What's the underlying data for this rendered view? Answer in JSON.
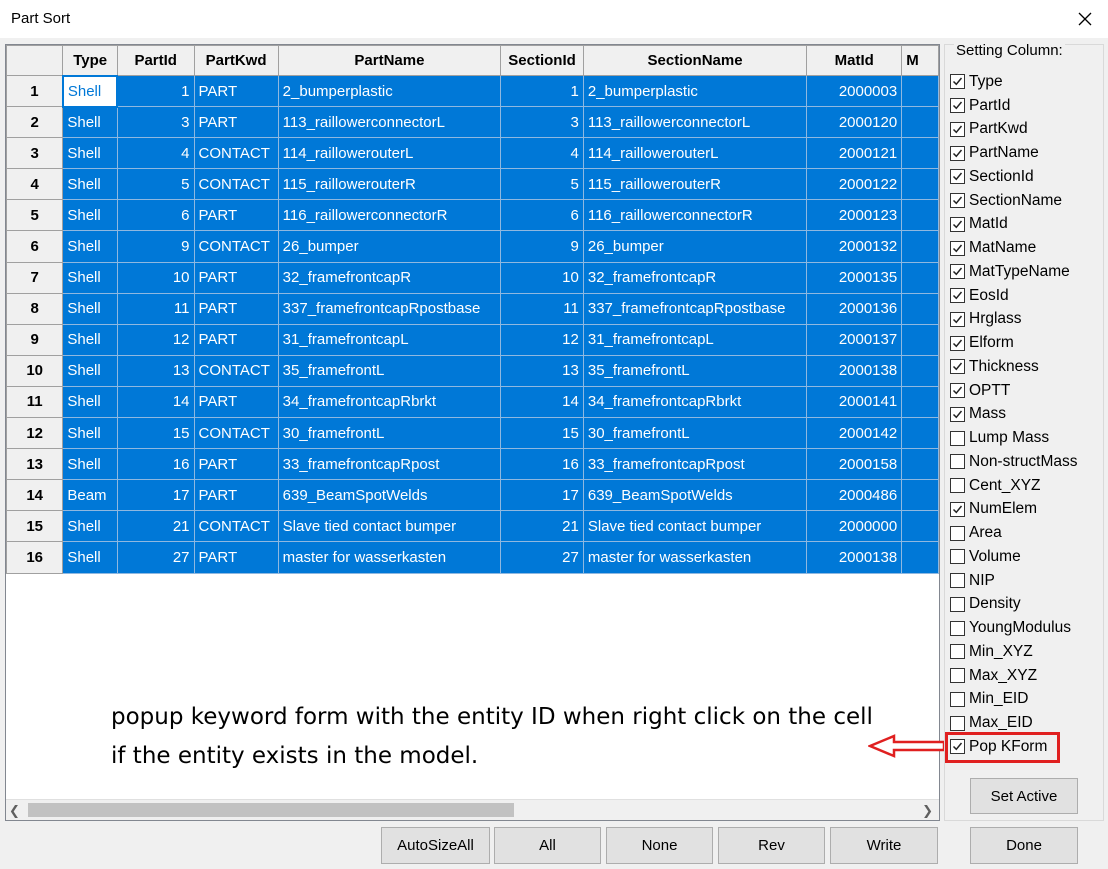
{
  "window": {
    "title": "Part Sort"
  },
  "grid": {
    "columns": [
      "Type",
      "PartId",
      "PartKwd",
      "PartName",
      "SectionId",
      "SectionName",
      "MatId",
      "M"
    ],
    "rows": [
      {
        "no": "1",
        "type": "Shell",
        "partid": "1",
        "partkwd": "PART",
        "partname": "2_bumperplastic",
        "sectionid": "1",
        "sectionname": "2_bumperplastic",
        "matid": "2000003"
      },
      {
        "no": "2",
        "type": "Shell",
        "partid": "3",
        "partkwd": "PART",
        "partname": "113_raillowerconnectorL",
        "sectionid": "3",
        "sectionname": "113_raillowerconnectorL",
        "matid": "2000120"
      },
      {
        "no": "3",
        "type": "Shell",
        "partid": "4",
        "partkwd": "CONTACT",
        "partname": "114_raillowerouterL",
        "sectionid": "4",
        "sectionname": "114_raillowerouterL",
        "matid": "2000121"
      },
      {
        "no": "4",
        "type": "Shell",
        "partid": "5",
        "partkwd": "CONTACT",
        "partname": "115_raillowerouterR",
        "sectionid": "5",
        "sectionname": "115_raillowerouterR",
        "matid": "2000122"
      },
      {
        "no": "5",
        "type": "Shell",
        "partid": "6",
        "partkwd": "PART",
        "partname": "116_raillowerconnectorR",
        "sectionid": "6",
        "sectionname": "116_raillowerconnectorR",
        "matid": "2000123"
      },
      {
        "no": "6",
        "type": "Shell",
        "partid": "9",
        "partkwd": "CONTACT",
        "partname": "26_bumper",
        "sectionid": "9",
        "sectionname": "26_bumper",
        "matid": "2000132"
      },
      {
        "no": "7",
        "type": "Shell",
        "partid": "10",
        "partkwd": "PART",
        "partname": "32_framefrontcapR",
        "sectionid": "10",
        "sectionname": "32_framefrontcapR",
        "matid": "2000135"
      },
      {
        "no": "8",
        "type": "Shell",
        "partid": "11",
        "partkwd": "PART",
        "partname": "337_framefrontcapRpostbase",
        "sectionid": "11",
        "sectionname": "337_framefrontcapRpostbase",
        "matid": "2000136"
      },
      {
        "no": "9",
        "type": "Shell",
        "partid": "12",
        "partkwd": "PART",
        "partname": "31_framefrontcapL",
        "sectionid": "12",
        "sectionname": "31_framefrontcapL",
        "matid": "2000137"
      },
      {
        "no": "10",
        "type": "Shell",
        "partid": "13",
        "partkwd": "CONTACT",
        "partname": "35_framefrontL",
        "sectionid": "13",
        "sectionname": "35_framefrontL",
        "matid": "2000138"
      },
      {
        "no": "11",
        "type": "Shell",
        "partid": "14",
        "partkwd": "PART",
        "partname": "34_framefrontcapRbrkt",
        "sectionid": "14",
        "sectionname": "34_framefrontcapRbrkt",
        "matid": "2000141"
      },
      {
        "no": "12",
        "type": "Shell",
        "partid": "15",
        "partkwd": "CONTACT",
        "partname": "30_framefrontL",
        "sectionid": "15",
        "sectionname": "30_framefrontL",
        "matid": "2000142"
      },
      {
        "no": "13",
        "type": "Shell",
        "partid": "16",
        "partkwd": "PART",
        "partname": "33_framefrontcapRpost",
        "sectionid": "16",
        "sectionname": "33_framefrontcapRpost",
        "matid": "2000158"
      },
      {
        "no": "14",
        "type": "Beam",
        "partid": "17",
        "partkwd": "PART",
        "partname": "639_BeamSpotWelds",
        "sectionid": "17",
        "sectionname": "639_BeamSpotWelds",
        "matid": "2000486"
      },
      {
        "no": "15",
        "type": "Shell",
        "partid": "21",
        "partkwd": "CONTACT",
        "partname": "Slave tied contact bumper",
        "sectionid": "21",
        "sectionname": "Slave tied contact bumper",
        "matid": "2000000"
      },
      {
        "no": "16",
        "type": "Shell",
        "partid": "27",
        "partkwd": "PART",
        "partname": "master for wasserkasten",
        "sectionid": "27",
        "sectionname": "master for wasserkasten",
        "matid": "2000138"
      }
    ]
  },
  "annotation": {
    "line1": "popup keyword form with the entity ID when right click on the cell",
    "line2": "if the entity exists in the model."
  },
  "settings": {
    "title": "Setting Column:",
    "items": [
      {
        "label": "Type",
        "checked": true
      },
      {
        "label": "PartId",
        "checked": true
      },
      {
        "label": "PartKwd",
        "checked": true
      },
      {
        "label": "PartName",
        "checked": true
      },
      {
        "label": "SectionId",
        "checked": true
      },
      {
        "label": "SectionName",
        "checked": true
      },
      {
        "label": "MatId",
        "checked": true
      },
      {
        "label": "MatName",
        "checked": true
      },
      {
        "label": "MatTypeName",
        "checked": true
      },
      {
        "label": "EosId",
        "checked": true
      },
      {
        "label": "Hrglass",
        "checked": true
      },
      {
        "label": "Elform",
        "checked": true
      },
      {
        "label": "Thickness",
        "checked": true
      },
      {
        "label": "OPTT",
        "checked": true
      },
      {
        "label": "Mass",
        "checked": true
      },
      {
        "label": "Lump Mass",
        "checked": false
      },
      {
        "label": "Non-structMass",
        "checked": false
      },
      {
        "label": "Cent_XYZ",
        "checked": false
      },
      {
        "label": "NumElem",
        "checked": true
      },
      {
        "label": "Area",
        "checked": false
      },
      {
        "label": "Volume",
        "checked": false
      },
      {
        "label": "NIP",
        "checked": false
      },
      {
        "label": "Density",
        "checked": false
      },
      {
        "label": "YoungModulus",
        "checked": false
      },
      {
        "label": "Min_XYZ",
        "checked": false
      },
      {
        "label": "Max_XYZ",
        "checked": false
      },
      {
        "label": "Min_EID",
        "checked": false
      },
      {
        "label": "Max_EID",
        "checked": false
      },
      {
        "label": "Pop KForm",
        "checked": true
      }
    ],
    "set_active": "Set Active"
  },
  "buttons": {
    "autosize": "AutoSizeAll",
    "all": "All",
    "none": "None",
    "rev": "Rev",
    "write": "Write",
    "done": "Done"
  },
  "colors": {
    "selection": "#0078d7",
    "highlight": "#e02020"
  }
}
